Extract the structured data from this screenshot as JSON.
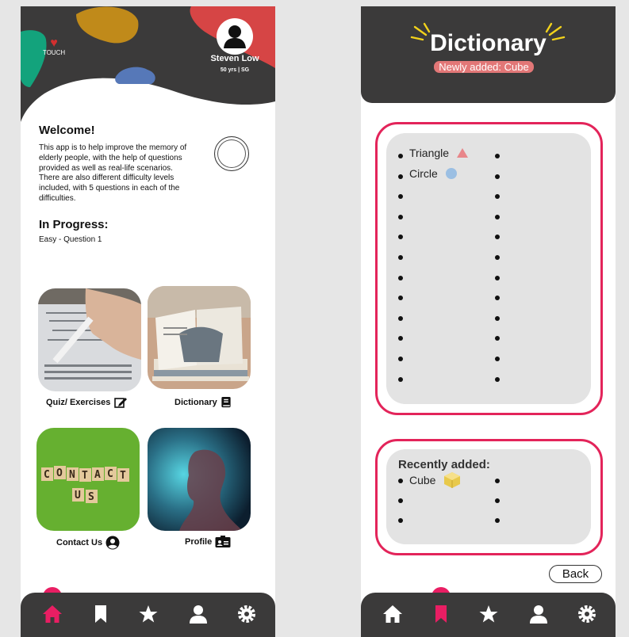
{
  "home": {
    "brand_text": "TOUCH",
    "user": {
      "name": "Steven Low",
      "meta": "50 yrs | SG"
    },
    "welcome": {
      "title": "Welcome!",
      "body": "This app is to help improve the memory of elderly people, with the help of questions provided as well as real-life scenarios. There are also different difficulty levels included, with 5 questions in each of the difficulties."
    },
    "progress": {
      "title": "In Progress:",
      "value": "Easy - Question 1"
    },
    "tiles": [
      {
        "label": "Quiz/ Exercises",
        "icon": "edit-icon"
      },
      {
        "label": "Dictionary",
        "icon": "book-icon"
      },
      {
        "label": "Contact Us",
        "icon": "user-circle-icon"
      },
      {
        "label": "Profile",
        "icon": "id-card-icon"
      }
    ],
    "tile_image_text": "CONTACT US",
    "active_tab": "home"
  },
  "dictionary": {
    "title": "Dictionary",
    "subtitle_prefix": "Newly added:",
    "subtitle_value": "Cube",
    "entries": [
      {
        "label": "Triangle",
        "icon": "triangle-icon"
      },
      {
        "label": "Circle",
        "icon": "circle-icon"
      }
    ],
    "recent_title": "Recently added:",
    "recent_entries": [
      {
        "label": "Cube",
        "icon": "cube-icon"
      }
    ],
    "back_label": "Back",
    "active_tab": "bookmark"
  },
  "tabs": [
    "home-icon",
    "bookmark-icon",
    "star-icon",
    "user-icon",
    "settings-icon"
  ],
  "colors": {
    "dark": "#3b3a3a",
    "accent": "#e91e63",
    "frame": "#e3245a",
    "panel": "#e3e3e3",
    "badge": "#e27777",
    "triangle": "#e8868a",
    "circle": "#9bbfe3",
    "cube": "#e8c94b"
  }
}
